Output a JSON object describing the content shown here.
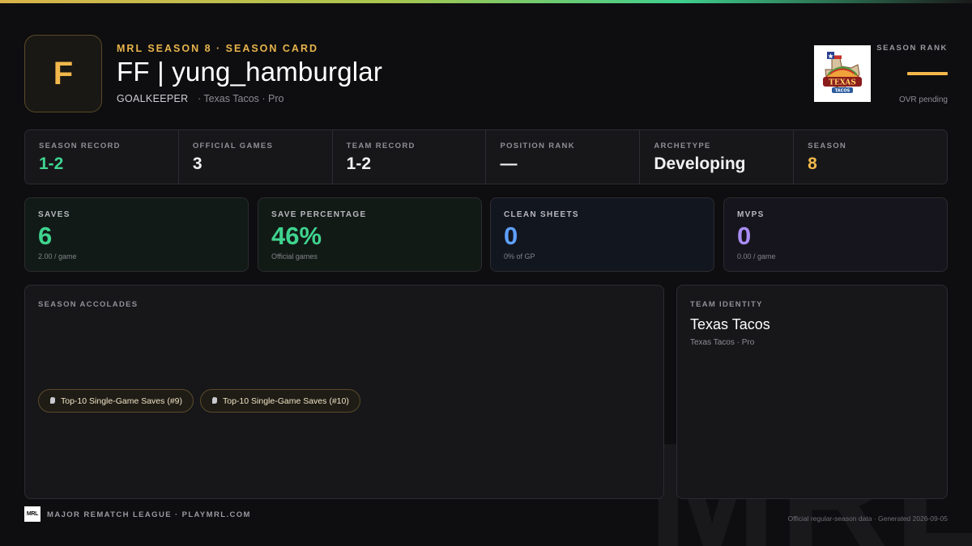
{
  "watermark": "MRL",
  "header": {
    "grade": "F",
    "eyebrow": "MRL SEASON 8 · SEASON CARD",
    "player_name": "FF | yung_hamburglar",
    "position": "GOALKEEPER",
    "team_line": "· Texas Tacos · Pro",
    "team_logo_text": "TEXAS TACOS",
    "rank_label": "SEASON RANK",
    "rank_note": "OVR pending"
  },
  "info_strip": [
    {
      "label": "SEASON RECORD",
      "value": "1-2",
      "accent": "green"
    },
    {
      "label": "OFFICIAL GAMES",
      "value": "3",
      "accent": "none"
    },
    {
      "label": "TEAM RECORD",
      "value": "1-2",
      "accent": "none"
    },
    {
      "label": "POSITION RANK",
      "value": "—",
      "accent": "none"
    },
    {
      "label": "ARCHETYPE",
      "value": "Developing",
      "accent": "none"
    },
    {
      "label": "SEASON",
      "value": "8",
      "accent": "gold"
    }
  ],
  "stats": [
    {
      "label": "SAVES",
      "value": "6",
      "sub": "2.00 / game"
    },
    {
      "label": "SAVE PERCENTAGE",
      "value": "46%",
      "sub": "Official games"
    },
    {
      "label": "CLEAN SHEETS",
      "value": "0",
      "sub": "0% of GP"
    },
    {
      "label": "MVPS",
      "value": "0",
      "sub": "0.00 / game"
    }
  ],
  "accolades": {
    "label": "SEASON ACCOLADES",
    "items": [
      {
        "icon": "glove-icon",
        "text": "Top-10 Single-Game Saves (#9)"
      },
      {
        "icon": "glove-icon",
        "text": "Top-10 Single-Game Saves (#10)"
      }
    ]
  },
  "team_identity": {
    "label": "TEAM IDENTITY",
    "name": "Texas Tacos",
    "sub": "Texas Tacos · Pro"
  },
  "footer": {
    "logo": "MRL",
    "text": "MAJOR REMATCH LEAGUE · PLAYMRL.COM",
    "right": "Official regular-season data · Generated 2026-09-05"
  },
  "colors": {
    "accent_gold": "#f2b84b",
    "green": "#3fd48f",
    "blue": "#5fa0ff",
    "purple": "#a98cf5"
  }
}
